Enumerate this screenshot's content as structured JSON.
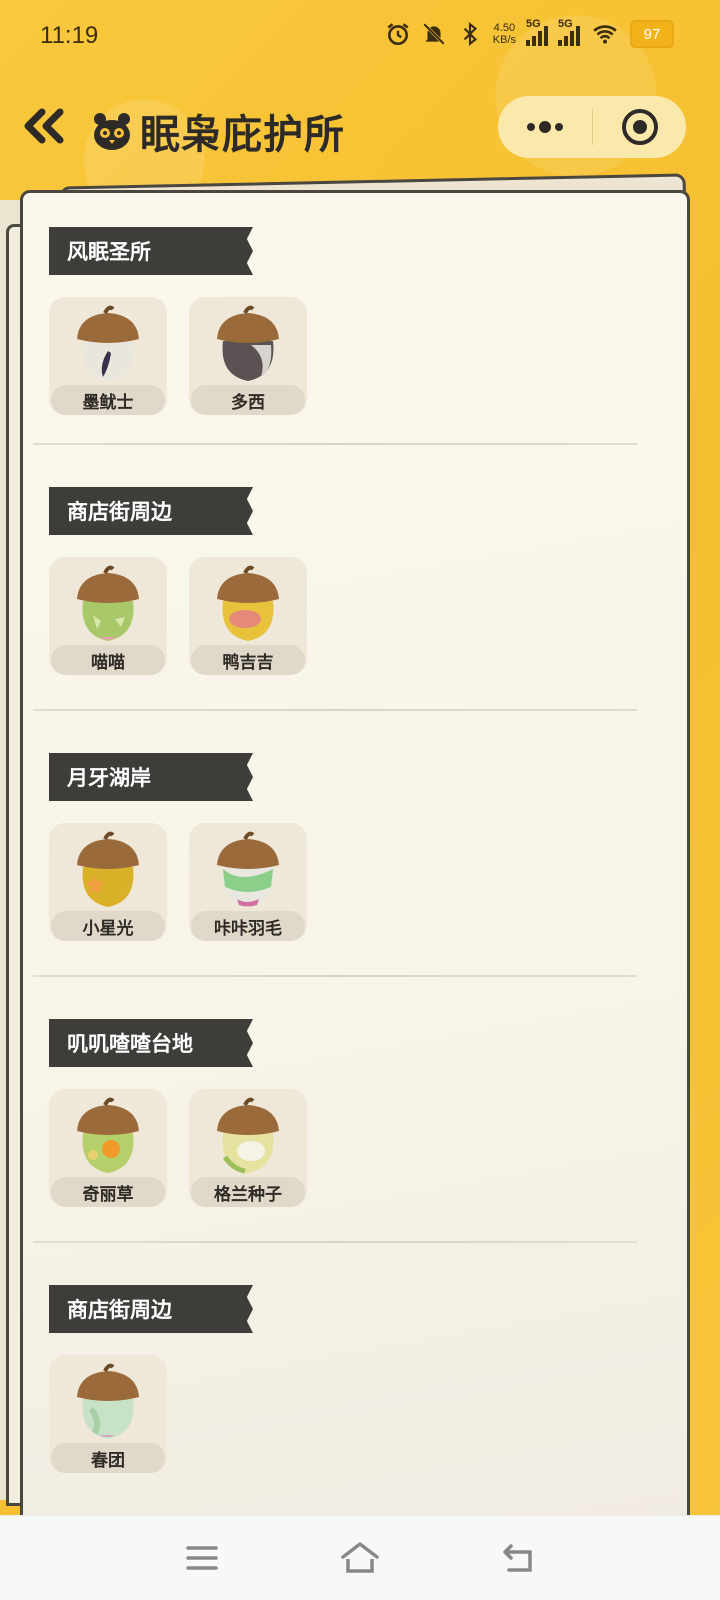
{
  "status_bar": {
    "time": "11:19",
    "net_speed_value": "4.50",
    "net_speed_unit": "KB/s",
    "signal1_label": "5G",
    "signal2_label": "5G",
    "battery": "97"
  },
  "header": {
    "title": "眠枭庇护所"
  },
  "sections": [
    {
      "title": "风眠圣所",
      "items": [
        {
          "label": "墨鱿士"
        },
        {
          "label": "多西"
        }
      ]
    },
    {
      "title": "商店街周边",
      "items": [
        {
          "label": "喵喵"
        },
        {
          "label": "鸭吉吉"
        }
      ]
    },
    {
      "title": "月牙湖岸",
      "items": [
        {
          "label": "小星光"
        },
        {
          "label": "咔咔羽毛"
        }
      ]
    },
    {
      "title": "叽叽喳喳台地",
      "items": [
        {
          "label": "奇丽草"
        },
        {
          "label": "格兰种子"
        }
      ]
    },
    {
      "title": "商店街周边",
      "items": [
        {
          "label": "春团"
        }
      ]
    }
  ],
  "colors": {
    "background": "#f7c23a",
    "tag_bg": "#3f3d3a",
    "card_bg": "#faf7ec"
  }
}
